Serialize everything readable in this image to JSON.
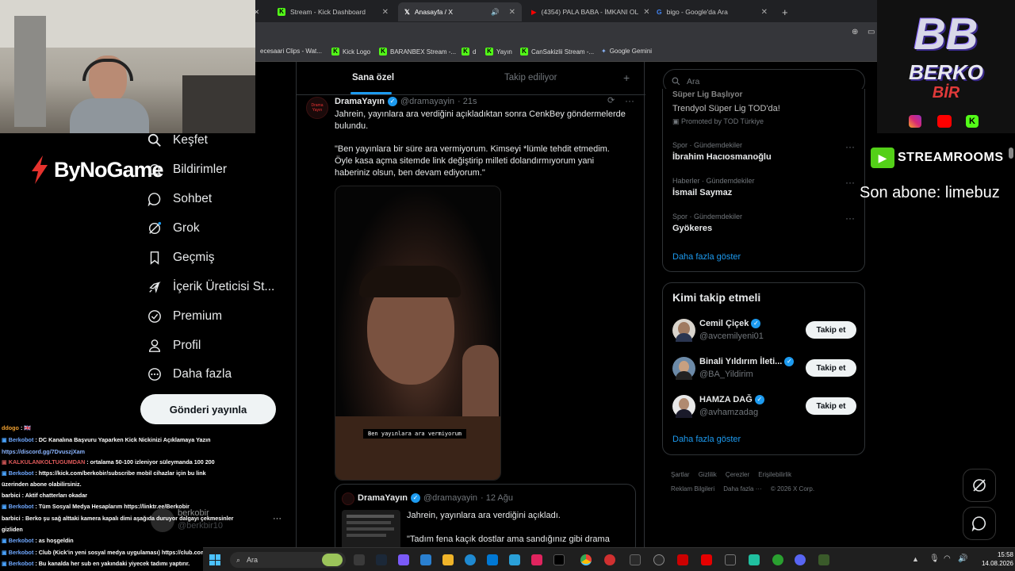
{
  "browser": {
    "tabs": [
      {
        "label": "Stream - Kick Dashboard"
      },
      {
        "label": "Anasayfa / X"
      },
      {
        "label": "(4354) PALA BABA - İMKANI OL"
      },
      {
        "label": "bigo - Google'da Ara"
      }
    ],
    "new_tab": "+",
    "bookmarks": [
      "ecesaari Clips - Wat...",
      "Kick Logo",
      "BARANBEX Stream -...",
      "d",
      "Yayın",
      "CanSakizlii Stream -...",
      "Google Gemini"
    ]
  },
  "overlay": {
    "brand_left": "ByNoGame",
    "logo_right_line1": "BB",
    "logo_right_line2": "BERKO",
    "logo_right_line3": "BİR",
    "streamrooms": "STREAMROOMS",
    "last_sub": "Son abone: limebuz"
  },
  "nav": {
    "items": [
      {
        "label": "Keşfet"
      },
      {
        "label": "Bildirimler"
      },
      {
        "label": "Sohbet"
      },
      {
        "label": "Grok"
      },
      {
        "label": "Geçmiş"
      },
      {
        "label": "İçerik Üreticisi St..."
      },
      {
        "label": "Premium"
      },
      {
        "label": "Profil"
      },
      {
        "label": "Daha fazla"
      }
    ],
    "post_button": "Gönderi yayınla",
    "account_name": "berkobir",
    "account_handle": "@berkbir10"
  },
  "feed": {
    "tab_for_you": "Sana özel",
    "tab_following": "Takip ediliyor",
    "add": "+",
    "tweet": {
      "avatar_text": "Drama Yayın",
      "name": "DramaYayın",
      "handle": "@dramayayin",
      "time": "· 21s",
      "text1": "Jahrein, yayınlara ara verdiğini açıkladıktan sonra CenkBey göndermelerde bulundu.",
      "text2": "\"Ben yayınlara bir süre ara vermiyorum. Kimseyi *lümle tehdit etmedim. Öyle kasa açma sitemde link değiştirip milleti dolandırmıyorum yani haberiniz olsun, ben devam ediyorum.\"",
      "video_caption": "Ben yayınlara ara vermiyorum"
    },
    "quoted": {
      "name": "DramaYayın",
      "handle": "@dramayayin",
      "time": "· 12 Ağu",
      "text1": "Jahrein, yayınlara ara verdiğini açıkladı.",
      "text2": "\"Tadım fena kaçık dostlar ama sandığınız gibi drama"
    }
  },
  "sidebar": {
    "search_placeholder": "Ara",
    "trends_partial_header": "Süper Lig Başlıyor",
    "promo": {
      "title": "Trendyol Süper Lig TOD'da!",
      "by": "Promoted by TOD Türkiye"
    },
    "trends": [
      {
        "cat": "Spor · Gündemdekiler",
        "title": "İbrahim Hacıosmanoğlu"
      },
      {
        "cat": "Haberler · Gündemdekiler",
        "title": "İsmail Saymaz"
      },
      {
        "cat": "Spor · Gündemdekiler",
        "title": "Gyökeres"
      }
    ],
    "show_more": "Daha fazla göster",
    "who_to_follow": "Kimi takip etmeli",
    "follow_label": "Takip et",
    "suggestions": [
      {
        "name": "Cemil Çiçek",
        "handle": "@avcemilyeni01"
      },
      {
        "name": "Binali Yıldırım İleti...",
        "handle": "@BA_Yildirim"
      },
      {
        "name": "HAMZA DAĞ",
        "handle": "@avhamzadag"
      }
    ],
    "show_more2": "Daha fazla göster",
    "footer": [
      "Şartlar",
      "Gizlilik",
      "Çerezler",
      "Erişilebilirlik",
      "Reklam Bilgileri",
      "Daha fazla ···",
      "© 2026 X Corp."
    ]
  },
  "chat": [
    {
      "user": "ddogo",
      "msg": " : 🇬🇧"
    },
    {
      "user": "Berkobot",
      "msg": " : DC Kanalına Başvuru Yaparken Kick Nickinizi Açıklamaya Yazın"
    },
    {
      "user": "",
      "msg": "https://discord.gg/7DvuszjXam"
    },
    {
      "user": "KALKULANKOLTUGUMDAN",
      "msg": " : ortalama 50-100 izleniyor süleymanda 100 200"
    },
    {
      "user": "Berkobot",
      "msg": " : https://kick.com/berkobir/subscribe mobil cihazlar için bu link"
    },
    {
      "user": "",
      "msg": "üzerinden abone olabilirsiniz."
    },
    {
      "user": "barbici",
      "msg": " : Aktif chatterları okadar"
    },
    {
      "user": "Berkobot",
      "msg": " : Tüm Sosyal Medya Hesaplarım https://linktr.ee/Berkobir"
    },
    {
      "user": "barbici",
      "msg": " : Berko şu sağ alttaki kamera kapalı dimi aşağıda duruyor dalgayı çekmesinler"
    },
    {
      "user": "",
      "msg": "gizliden"
    },
    {
      "user": "Berkobot",
      "msg": " : as hoşgeldin"
    },
    {
      "user": "Berkobot",
      "msg": " : Club (Kick'in yeni sosyal medya uygulaması) https://club.com/berkobir"
    },
    {
      "user": "Berkobot",
      "msg": " : Bu kanalda her sub en yakındaki yiyecek tadımı yaptırır."
    }
  ],
  "taskbar": {
    "search": "Ara",
    "time": "15:58",
    "date": "14.08.2026"
  }
}
